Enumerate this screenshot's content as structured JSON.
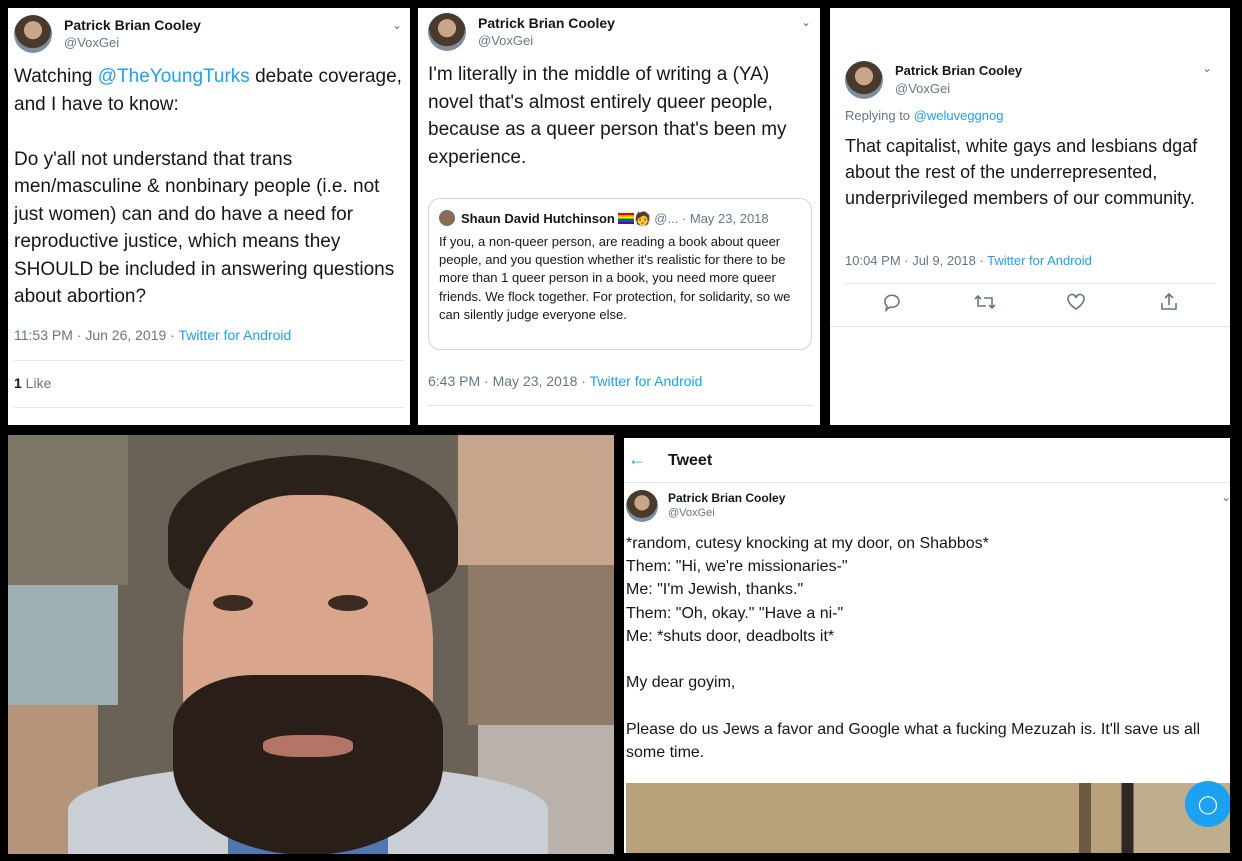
{
  "tweet1": {
    "name": "Patrick Brian Cooley",
    "handle": "@VoxGei",
    "text_before": "Watching ",
    "mention": "@TheYoungTurks",
    "text_after": " debate coverage, and I have to know:\n\nDo y'all not understand that trans men/masculine & nonbinary people (i.e. not just women) can and do have a need for reproductive justice, which means they SHOULD be included in answering questions about abortion?",
    "time": "11:53 PM · Jun 26, 2019 · ",
    "source": "Twitter for Android",
    "likes_count": "1",
    "likes_label": " Like"
  },
  "tweet2": {
    "name": "Patrick Brian Cooley",
    "handle": "@VoxGei",
    "text": "I'm literally in the middle of writing a (YA) novel that's almost entirely queer people, because as a queer person that's been my experience.",
    "quote": {
      "name": "Shaun David Hutchinson",
      "handle_trunc": " @...",
      "date": " · May 23, 2018",
      "text": "If you, a non-queer person, are reading a book about queer people, and you question whether it's realistic for there to be more than 1 queer person in a book, you need more queer friends. We flock together. For protection, for solidarity, so we can silently judge everyone else."
    },
    "time": "6:43 PM · May 23, 2018 · ",
    "source": "Twitter for Android"
  },
  "tweet3": {
    "name": "Patrick Brian Cooley",
    "handle": "@VoxGei",
    "replying_label": "Replying to ",
    "replying_to": "@weluveggnog",
    "text": "That capitalist, white gays and lesbians dgaf about the rest of the underrepresented, underprivileged members of our community.",
    "time": "10:04 PM · Jul 9, 2018 · ",
    "source": "Twitter for Android"
  },
  "tweet4": {
    "header_title": "Tweet",
    "name": "Patrick Brian Cooley",
    "handle": "@VoxGei",
    "text": "*random, cutesy knocking at my door, on Shabbos*\nThem: \"Hi, we're missionaries-\"\nMe: \"I'm Jewish, thanks.\"\nThem: \"Oh, okay.\" \"Have a ni-\"\nMe: *shuts door, deadbolts it*\n\nMy dear goyim,\n\nPlease do us Jews a favor and Google what a fucking Mezuzah is. It'll save us all some time."
  },
  "icons": {
    "chevron": "chevron-down-icon",
    "reply": "reply-icon",
    "retweet": "retweet-icon",
    "like": "heart-icon",
    "share": "share-icon",
    "back": "back-arrow-icon",
    "compose": "compose-fab-icon"
  },
  "colors": {
    "link": "#1da1f2",
    "muted": "#657786",
    "divider": "#e1e8ed"
  }
}
